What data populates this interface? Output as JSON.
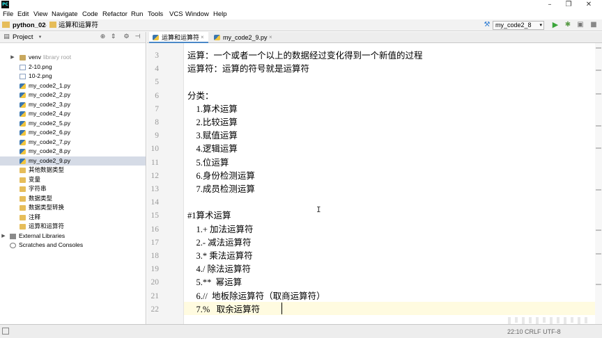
{
  "app": {
    "logo_text": "PC"
  },
  "window_controls": {
    "minimize": "–",
    "restore": "❐",
    "close": "✕"
  },
  "menu": [
    "File",
    "Edit",
    "View",
    "Navigate",
    "Code",
    "Refactor",
    "Run",
    "Tools",
    "VCS",
    "Window",
    "Help"
  ],
  "breadcrumb": {
    "project": "python_02",
    "file": "运算和运算符"
  },
  "run_config": {
    "selected": "my_code2_8"
  },
  "project_panel": {
    "title": "Project"
  },
  "tree": [
    {
      "label": "venv",
      "hint": "library root",
      "kind": "venv"
    },
    {
      "label": "2-10.png",
      "kind": "png"
    },
    {
      "label": "10-2.png",
      "kind": "png"
    },
    {
      "label": "my_code2_1.py",
      "kind": "py"
    },
    {
      "label": "my_code2_2.py",
      "kind": "py"
    },
    {
      "label": "my_code2_3.py",
      "kind": "py"
    },
    {
      "label": "my_code2_4.py",
      "kind": "py"
    },
    {
      "label": "my_code2_5.py",
      "kind": "py"
    },
    {
      "label": "my_code2_6.py",
      "kind": "py"
    },
    {
      "label": "my_code2_7.py",
      "kind": "py"
    },
    {
      "label": "my_code2_8.py",
      "kind": "py"
    },
    {
      "label": "my_code2_9.py",
      "kind": "py",
      "selected": true
    },
    {
      "label": "其他数据类型",
      "kind": "folder"
    },
    {
      "label": "变量",
      "kind": "folder"
    },
    {
      "label": "字符串",
      "kind": "folder"
    },
    {
      "label": "数据类型",
      "kind": "folder"
    },
    {
      "label": "数据类型转换",
      "kind": "folder"
    },
    {
      "label": "注释",
      "kind": "folder"
    },
    {
      "label": "运算和运算符",
      "kind": "folder"
    },
    {
      "label": "External Libraries",
      "kind": "lib"
    },
    {
      "label": "Scratches and Consoles",
      "kind": "scratch"
    }
  ],
  "tabs": [
    {
      "label": "运算和运算符",
      "close": "×",
      "active": true
    },
    {
      "label": "my_code2_9.py",
      "close": "×",
      "active": false
    }
  ],
  "editor": {
    "lines": [
      {
        "n": "3",
        "text": "运算：一个或者一个以上的数据经过变化得到一个新值的过程"
      },
      {
        "n": "4",
        "text": "运算符：运算的符号就是运算符"
      },
      {
        "n": "5",
        "text": ""
      },
      {
        "n": "6",
        "text": "分类："
      },
      {
        "n": "7",
        "text": "    1.算术运算"
      },
      {
        "n": "8",
        "text": "    2.比较运算"
      },
      {
        "n": "9",
        "text": "    3.赋值运算"
      },
      {
        "n": "10",
        "text": "    4.逻辑运算"
      },
      {
        "n": "11",
        "text": "    5.位运算"
      },
      {
        "n": "12",
        "text": "    6.身份检测运算"
      },
      {
        "n": "13",
        "text": "    7.成员检测运算"
      },
      {
        "n": "14",
        "text": ""
      },
      {
        "n": "15",
        "text": "#1算术运算"
      },
      {
        "n": "16",
        "text": "    1.+ 加法运算符"
      },
      {
        "n": "17",
        "text": "    2.- 减法运算符"
      },
      {
        "n": "18",
        "text": "    3.* 乘法运算符"
      },
      {
        "n": "19",
        "text": "    4./ 除法运算符"
      },
      {
        "n": "20",
        "text": "    5.**  幂运算"
      },
      {
        "n": "21",
        "text": "    6.//  地板除运算符（取商运算符）"
      },
      {
        "n": "22",
        "text": "    7.%   取余运算符"
      }
    ]
  },
  "status": {
    "position": "22:10",
    "line_sep": "CRLF",
    "encoding": "UTF-8"
  }
}
